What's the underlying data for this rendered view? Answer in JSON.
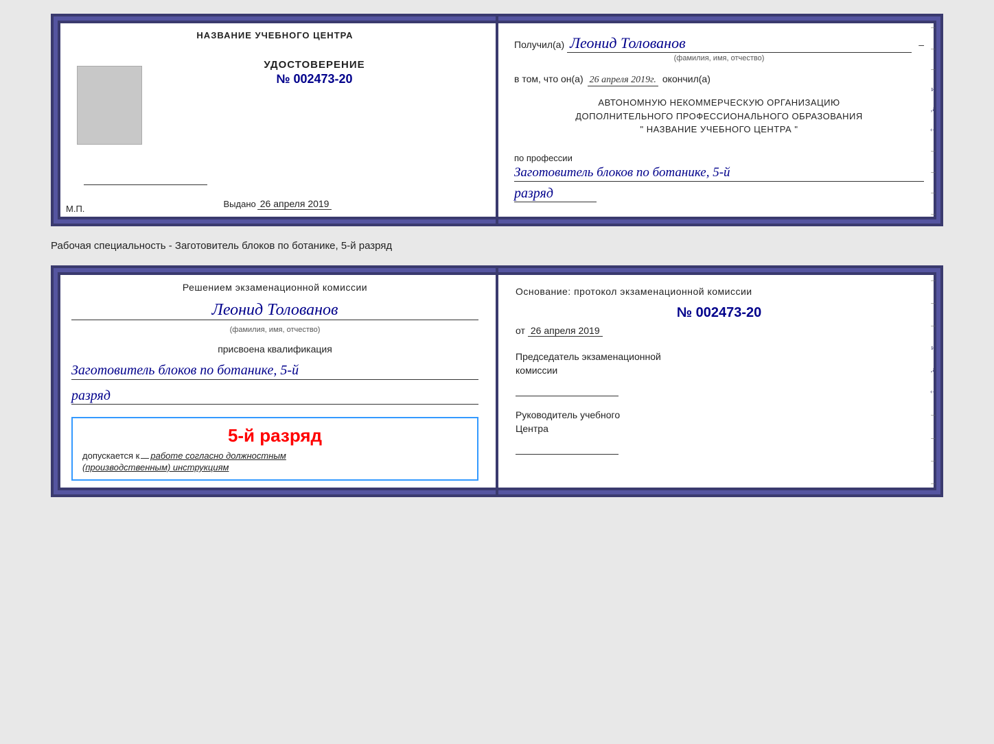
{
  "cert1": {
    "left": {
      "header": "НАЗВАНИЕ УЧЕБНОГО ЦЕНТРА",
      "udostoverenie": "УДОСТОВЕРЕНИЕ",
      "number": "№ 002473-20",
      "vydano_label": "Выдано",
      "vydano_date": "26 апреля 2019",
      "mp_label": "М.П."
    },
    "right": {
      "poluchil_label": "Получил(а)",
      "poluchil_name": "Леонид Толованов",
      "fio_hint": "(фамилия, имя, отчество)",
      "vtom_label": "в том, что он(а)",
      "vtom_date": "26 апреля 2019г.",
      "okonchil_label": "окончил(а)",
      "org_line1": "АВТОНОМНУЮ НЕКОММЕРЧЕСКУЮ ОРГАНИЗАЦИЮ",
      "org_line2": "ДОПОЛНИТЕЛЬНОГО ПРОФЕССИОНАЛЬНОГО ОБРАЗОВАНИЯ",
      "org_line3": "\"  НАЗВАНИЕ УЧЕБНОГО ЦЕНТРА  \"",
      "po_professii": "по профессии",
      "professiya": "Заготовитель блоков по ботанике, 5-й",
      "razryad": "разряд"
    }
  },
  "separator": "Рабочая специальность - Заготовитель блоков по ботанике, 5-й разряд",
  "cert2": {
    "left": {
      "resheniem": "Решением экзаменационной комиссии",
      "person_name": "Леонид Толованов",
      "fio_hint": "(фамилия, имя, отчество)",
      "prisvoena": "присвоена квалификация",
      "professiya": "Заготовитель блоков по ботанике, 5-й",
      "razryad": "разряд",
      "stamp_rank": "5-й разряд",
      "dopuskaetsya": "допускается к",
      "rabota": "работе согласно должностным",
      "instruktsii": "(производственным) инструкциям"
    },
    "right": {
      "osnovaniye": "Основание: протокол экзаменационной комиссии",
      "number": "№  002473-20",
      "ot_label": "от",
      "ot_date": "26 апреля 2019",
      "predsedatel_label": "Председатель экзаменационной",
      "komissii_label": "комиссии",
      "rukovoditel_label": "Руководитель учебного",
      "tsentra_label": "Центра"
    }
  }
}
